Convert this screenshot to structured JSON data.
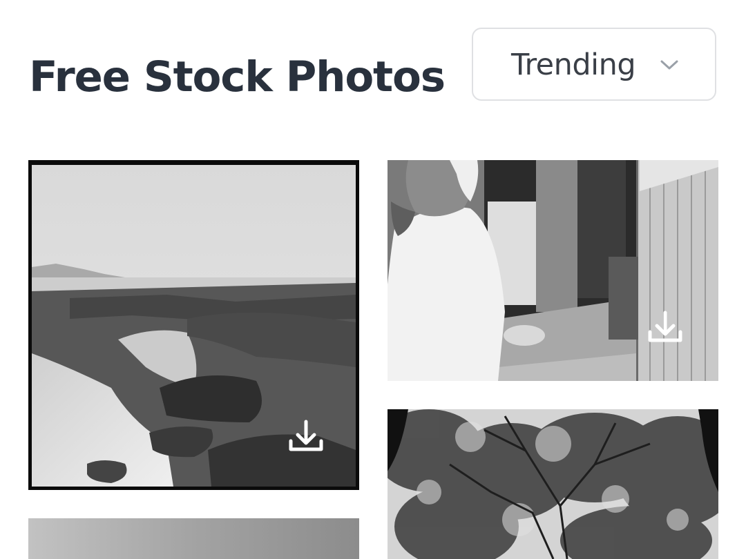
{
  "header": {
    "title": "Free Stock Photos"
  },
  "sort": {
    "selected": "Trending",
    "icon": "chevron-down-icon"
  },
  "gallery": {
    "photos": [
      {
        "subject": "rocky-shoreline",
        "action_icon": "download-icon"
      },
      {
        "subject": "elderly-man-in-doorway",
        "action_icon": "download-icon"
      },
      {
        "subject": "tree-canopy",
        "action_icon": null
      },
      {
        "subject": "overcast-sky",
        "action_icon": null
      }
    ]
  },
  "colors": {
    "title": "#29313d",
    "select_border": "#dfe0e3",
    "icon_overlay": "#ffffff"
  }
}
